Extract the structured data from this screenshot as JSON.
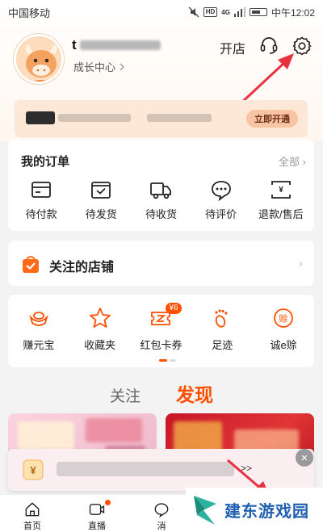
{
  "status_bar": {
    "carrier": "中国移动",
    "hd": "HD",
    "network": "4G",
    "time": "中午12:02"
  },
  "profile": {
    "username_visible": "t",
    "growth_center": "成长中心",
    "open_shop": "开店"
  },
  "vip_banner": {
    "open_label": "立即开通"
  },
  "orders": {
    "title": "我的订单",
    "all": "全部",
    "items": [
      {
        "label": "待付款",
        "icon": "wallet-icon"
      },
      {
        "label": "待发货",
        "icon": "package-check-icon"
      },
      {
        "label": "待收货",
        "icon": "truck-icon"
      },
      {
        "label": "待评价",
        "icon": "comment-icon"
      },
      {
        "label": "退款/售后",
        "icon": "refund-icon"
      }
    ]
  },
  "followed_shops": {
    "title": "关注的店铺"
  },
  "tools": {
    "items": [
      {
        "label": "赚元宝",
        "icon": "gold-ingot-icon"
      },
      {
        "label": "收藏夹",
        "icon": "star-icon"
      },
      {
        "label": "红包卡券",
        "icon": "coupon-icon",
        "badge": "¥6"
      },
      {
        "label": "足迹",
        "icon": "footprint-icon"
      },
      {
        "label": "诚e赊",
        "icon": "credit-icon",
        "icon_text": "赊"
      }
    ]
  },
  "feed_tabs": [
    {
      "label": "关注",
      "active": false
    },
    {
      "label": "发现",
      "active": true
    }
  ],
  "popup": {
    "more": ">>",
    "close": "×",
    "icon_text": "¥"
  },
  "bottom_nav": [
    {
      "label": "首页",
      "icon": "home-icon"
    },
    {
      "label": "直播",
      "icon": "live-camera-icon"
    },
    {
      "label": "消",
      "icon": "message-icon"
    }
  ],
  "watermark": {
    "text": "建东游戏园"
  },
  "colors": {
    "accent": "#ff5000",
    "annotation_arrow": "#e8323f",
    "watermark": "#1f5fb0"
  }
}
